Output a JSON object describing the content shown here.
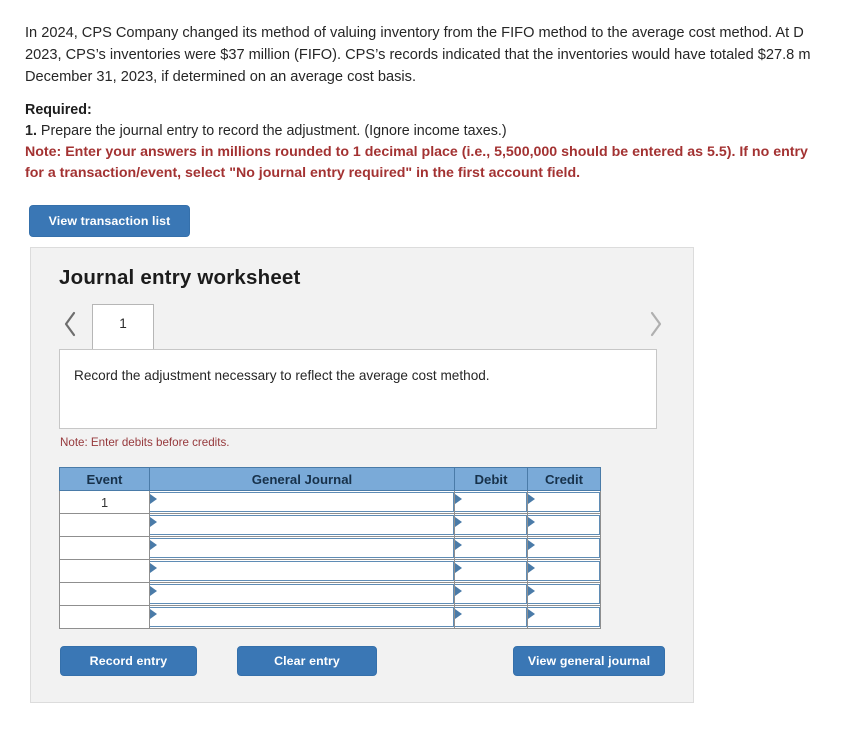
{
  "problem": {
    "lines": [
      "In 2024, CPS Company changed its method of valuing inventory from the FIFO method to the average cost method. At D",
      "2023, CPS’s inventories were $37 million (FIFO). CPS’s records indicated that the inventories would have totaled $27.8 m",
      "December 31, 2023, if determined on an average cost basis."
    ]
  },
  "required": {
    "title": "Required:",
    "item_number": "1.",
    "item_text": " Prepare the journal entry to record the adjustment. (Ignore income taxes.)",
    "note_lines": [
      "Note: Enter your answers in millions rounded to 1 decimal place (i.e., 5,500,000 should be entered as 5.5). If no entry",
      "for a transaction/event, select \"No journal entry required\" in the first account field."
    ],
    "note_color": "#a33232"
  },
  "toolbar": {
    "view_transaction_list_label": "View transaction list"
  },
  "worksheet": {
    "title": "Journal entry worksheet",
    "prev_icon": "chevron-left-icon",
    "next_icon": "chevron-right-icon",
    "tabs": [
      {
        "label": "1",
        "active": true
      }
    ],
    "description": "Record the adjustment necessary to reflect the average cost method.",
    "debits_note": "Note: Enter debits before credits.",
    "debits_note_color": "#96393c",
    "table": {
      "headers": [
        "Event",
        "General Journal",
        "Debit",
        "Credit"
      ],
      "header_bg": "#7aaad8",
      "rows": [
        {
          "event": "1",
          "general_journal": "",
          "debit": "",
          "credit": ""
        },
        {
          "event": "",
          "general_journal": "",
          "debit": "",
          "credit": ""
        },
        {
          "event": "",
          "general_journal": "",
          "debit": "",
          "credit": ""
        },
        {
          "event": "",
          "general_journal": "",
          "debit": "",
          "credit": ""
        },
        {
          "event": "",
          "general_journal": "",
          "debit": "",
          "credit": ""
        },
        {
          "event": "",
          "general_journal": "",
          "debit": "",
          "credit": ""
        }
      ]
    },
    "buttons": {
      "record_entry": "Record entry",
      "clear_entry": "Clear entry",
      "view_general_journal": "View general journal"
    },
    "accent_color": "#3a77b5"
  }
}
